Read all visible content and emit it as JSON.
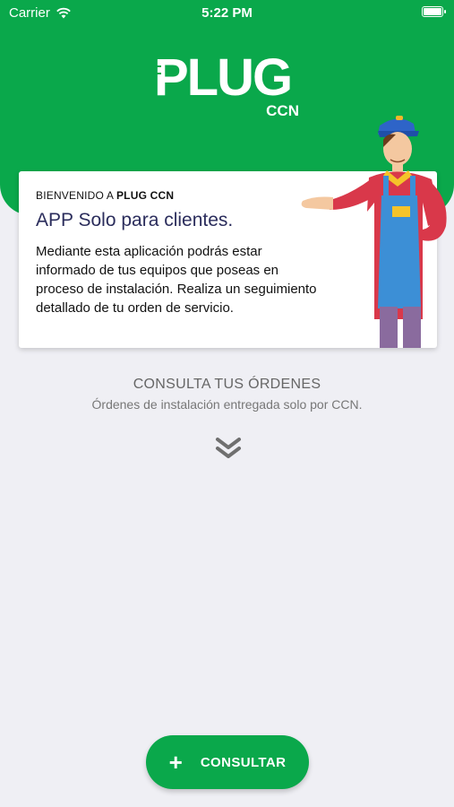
{
  "status_bar": {
    "carrier": "Carrier",
    "time": "5:22 PM"
  },
  "logo": {
    "main": "PLUG",
    "sub": "CCN"
  },
  "card": {
    "welcome_prefix": "BIENVENIDO A ",
    "welcome_brand": "PLUG CCN",
    "title": "APP Solo para clientes.",
    "body": "Mediante esta aplicación podrás estar informado de tus equipos que poseas en proceso de instalación. Realiza un seguimiento detallado de tu orden de servicio."
  },
  "section": {
    "title": "CONSULTA TUS ÓRDENES",
    "subtitle": "Órdenes de instalación entregada solo por CCN."
  },
  "fab": {
    "icon": "plus-icon",
    "label": "CONSULTAR"
  },
  "colors": {
    "brand_green": "#0aa84b",
    "background": "#efeff4",
    "title_navy": "#2b2d5c"
  }
}
